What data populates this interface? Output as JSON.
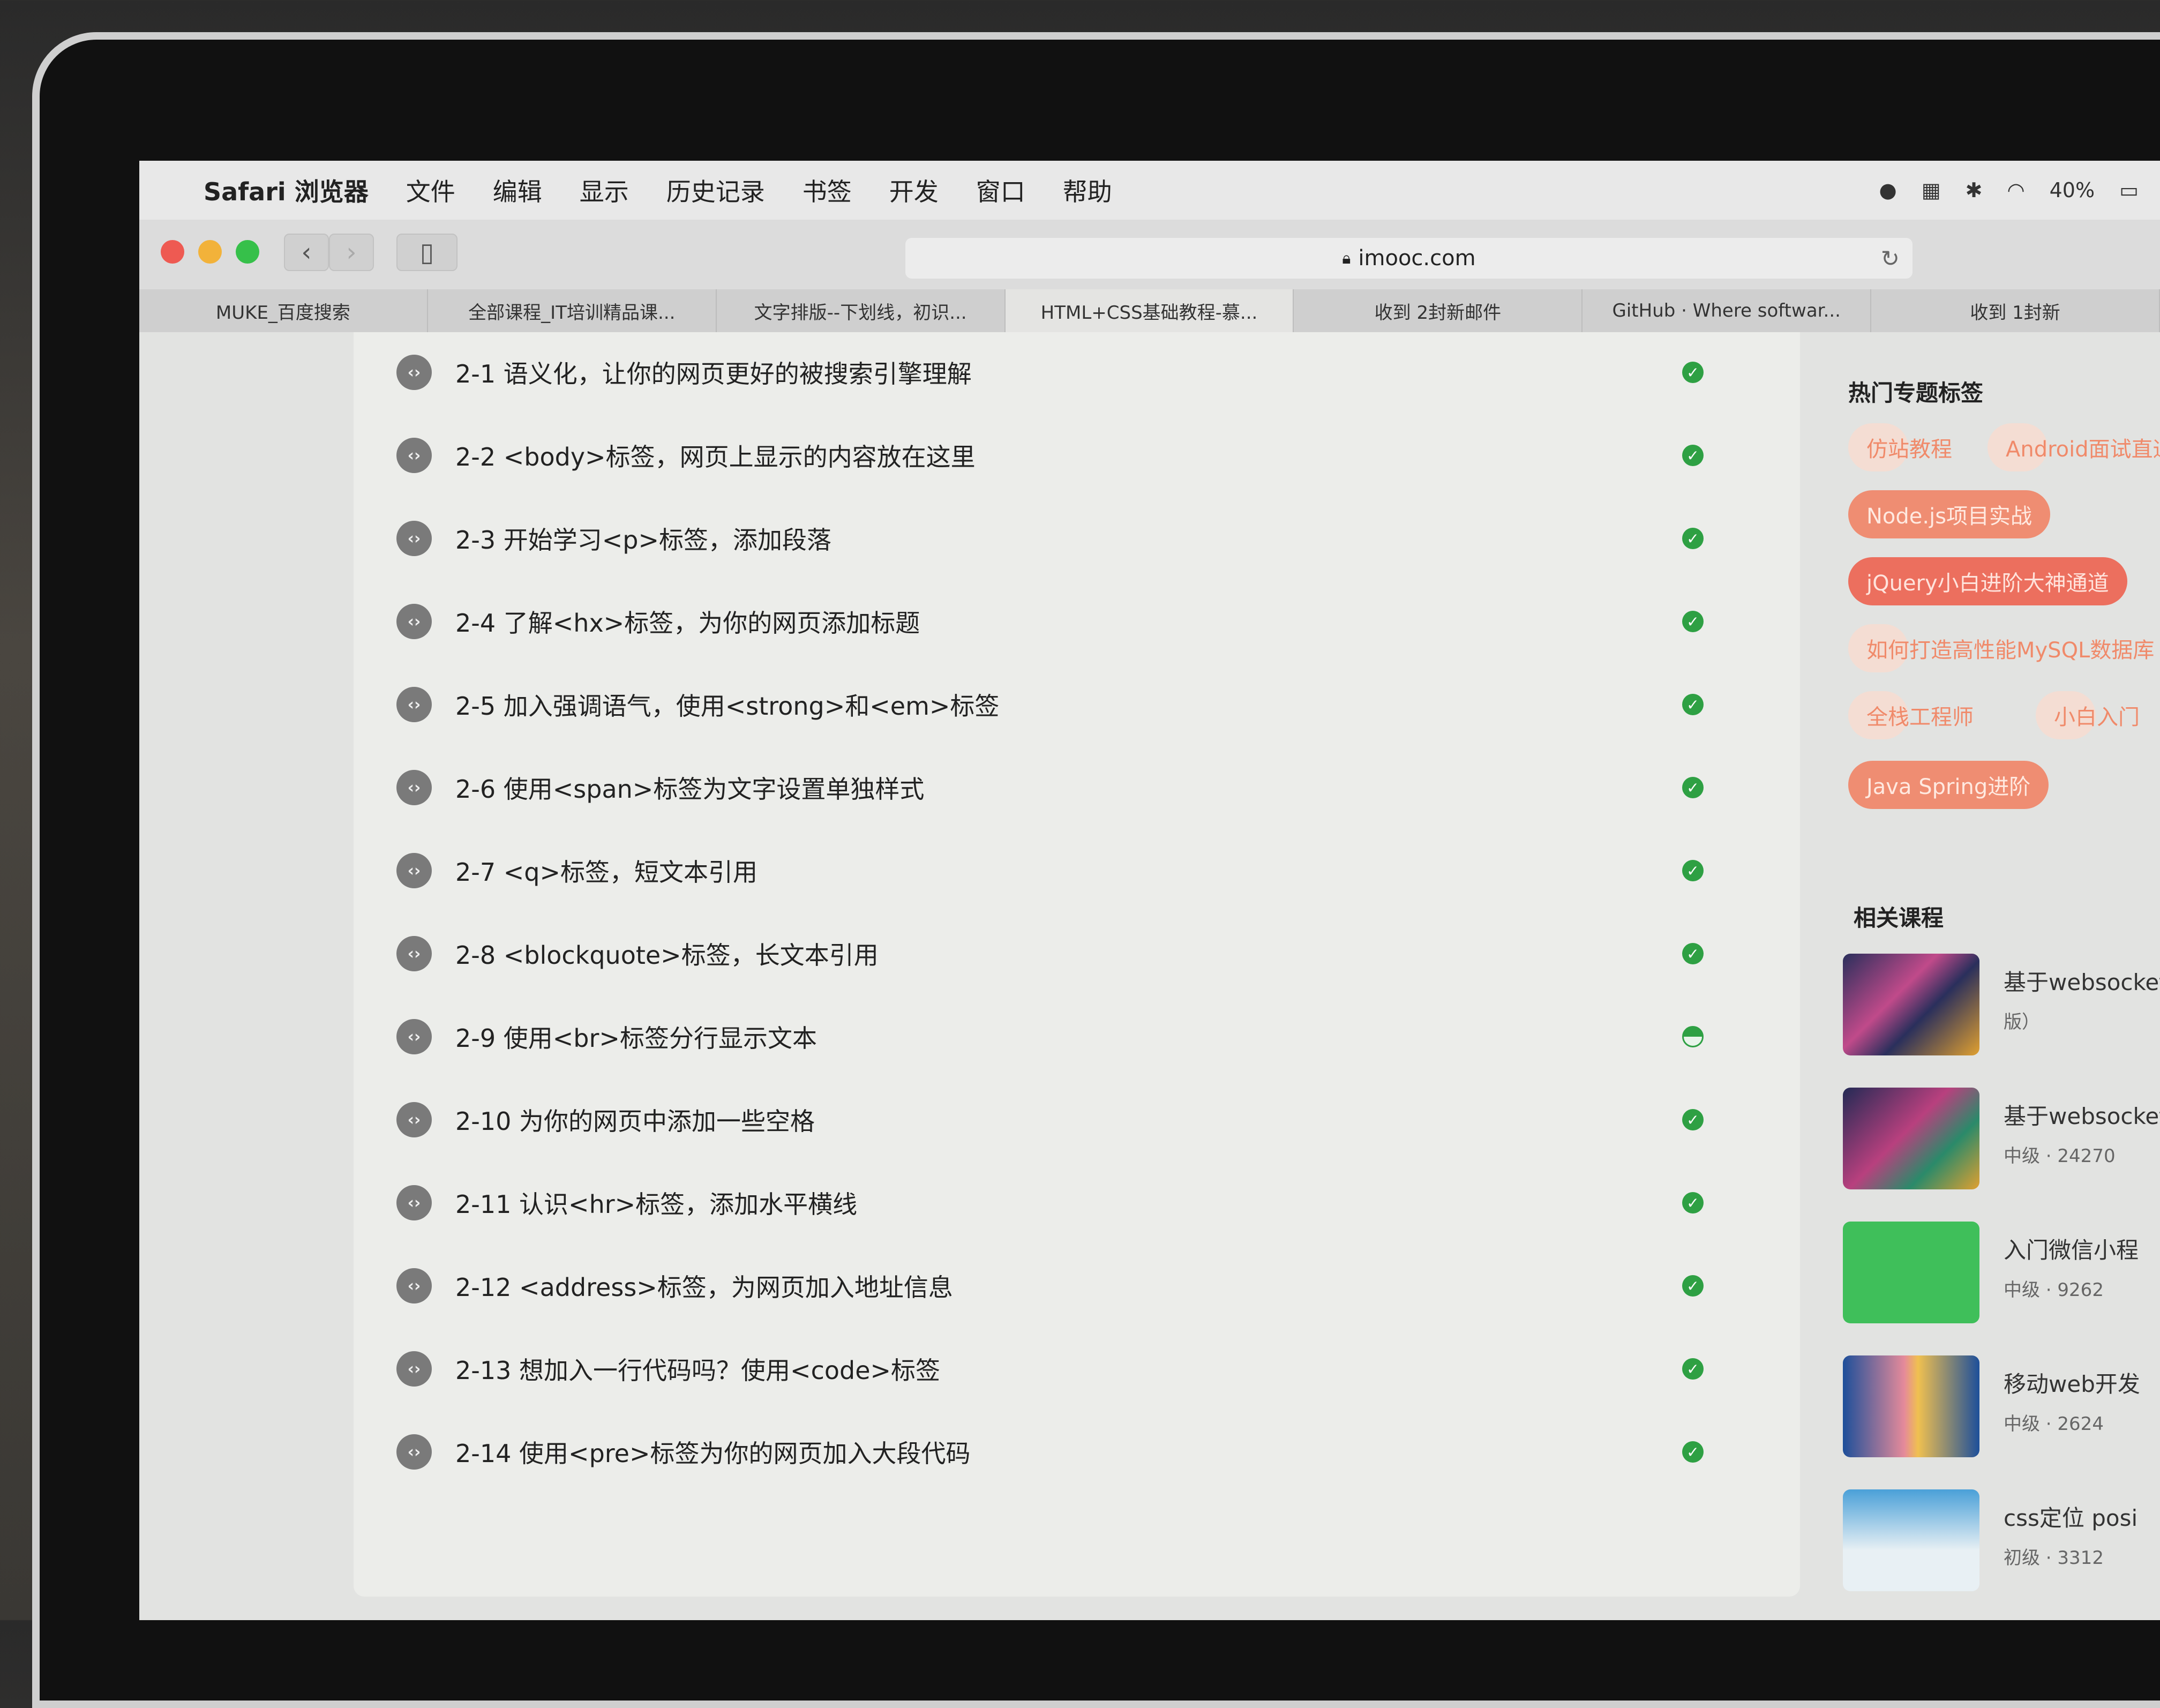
{
  "menubar": {
    "app_name": "Safari 浏览器",
    "items": [
      "文件",
      "编辑",
      "显示",
      "历史记录",
      "书签",
      "开发",
      "窗口",
      "帮助"
    ],
    "battery": "40%"
  },
  "toolbar": {
    "url": "imooc.com"
  },
  "tabs": [
    "MUKE_百度搜索",
    "全部课程_IT培训精品课...",
    "文字排版--下划线，初识...",
    "HTML+CSS基础教程-慕...",
    "收到 2封新邮件",
    "GitHub · Where softwar...",
    "收到 1封新"
  ],
  "lessons": [
    {
      "label": "2-1 语义化，让你的网页更好的被搜索引擎理解",
      "status": "done"
    },
    {
      "label": "2-2 <body>标签，网页上显示的内容放在这里",
      "status": "done"
    },
    {
      "label": "2-3 开始学习<p>标签，添加段落",
      "status": "done"
    },
    {
      "label": "2-4 了解<hx>标签，为你的网页添加标题",
      "status": "done"
    },
    {
      "label": "2-5 加入强调语气，使用<strong>和<em>标签",
      "status": "done"
    },
    {
      "label": "2-6 使用<span>标签为文字设置单独样式",
      "status": "done"
    },
    {
      "label": "2-7 <q>标签，短文本引用",
      "status": "done"
    },
    {
      "label": "2-8 <blockquote>标签，长文本引用",
      "status": "done"
    },
    {
      "label": "2-9 使用<br>标签分行显示文本",
      "status": "partial"
    },
    {
      "label": "2-10 为你的网页中添加一些空格",
      "status": "done"
    },
    {
      "label": "2-11 认识<hr>标签，添加水平横线",
      "status": "done"
    },
    {
      "label": "2-12 <address>标签，为网页加入地址信息",
      "status": "done"
    },
    {
      "label": "2-13 想加入一行代码吗？使用<code>标签",
      "status": "done"
    },
    {
      "label": "2-14 使用<pre>标签为你的网页加入大段代码",
      "status": "done"
    }
  ],
  "sidebar": {
    "hot_tags_title": "热门专题标签",
    "tags": [
      "仿站教程",
      "Android面试直通",
      "Node.js项目实战",
      "jQuery小白进阶大神通道",
      "如何打造高性能MySQL数据库",
      "全栈工程师",
      "小白入门",
      "Java Spring进阶"
    ],
    "related_title": "相关课程",
    "courses": [
      {
        "title": "基于websocket",
        "meta": "版）"
      },
      {
        "title": "基于websocket",
        "meta": "中级 · 24270"
      },
      {
        "title": "入门微信小程",
        "meta": "中级 · 9262"
      },
      {
        "title": "移动web开发",
        "meta": "中级 · 2624"
      },
      {
        "title": "css定位 posi",
        "meta": "初级 · 3312"
      }
    ]
  },
  "colors": {
    "check": "#2ea043",
    "tag_accent": "#ef8d72"
  }
}
